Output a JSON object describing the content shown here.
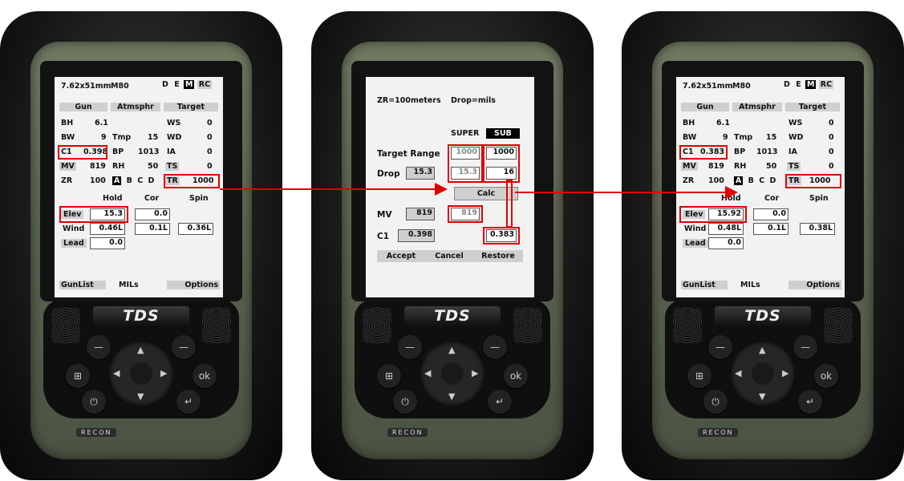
{
  "colors": {
    "highlight": "#e00000",
    "device_green": "#5b6450",
    "screen_bg": "#f2f2f2"
  },
  "main_screen_left": {
    "caliber": "7.62x51mm",
    "load": "M80",
    "modes": [
      "D",
      "E",
      "M",
      "RC"
    ],
    "gun_header": "Gun",
    "atm_header": "Atmsphr",
    "target_header": "Target",
    "bh_label": "BH",
    "bh_value": "6.1",
    "bw_label": "BW",
    "bw_value": "9",
    "c1_label": "C1",
    "c1_value": "0.398",
    "mv_label": "MV",
    "mv_value": "819",
    "zr_label": "ZR",
    "zr_value": "100",
    "tmp_label": "Tmp",
    "tmp_value": "15",
    "bp_label": "BP",
    "bp_value": "1013",
    "rh_label": "RH",
    "rh_value": "50",
    "set_labels": [
      "A",
      "B",
      "C",
      "D"
    ],
    "ws_label": "WS",
    "ws_value": "0",
    "wd_label": "WD",
    "wd_value": "0",
    "ia_label": "IA",
    "ia_value": "0",
    "ts_label": "TS",
    "ts_value": "0",
    "tr_label": "TR",
    "tr_value": "1000",
    "hold_header": "Hold",
    "cor_header": "Cor",
    "spin_header": "Spin",
    "elev_label": "Elev",
    "elev_value": "15.3",
    "elev_cor": "0.0",
    "wind_label": "Wind",
    "wind_value": "0.46L",
    "wind_cor": "0.1L",
    "wind_spin": "0.36L",
    "lead_label": "Lead",
    "lead_value": "0.0",
    "gunlist": "GunList",
    "units": "MILs",
    "options": "Options"
  },
  "calc_screen": {
    "zr_text": "ZR=100meters",
    "drop_text": "Drop=mils",
    "super_label": "SUPER",
    "sub_label": "SUB",
    "target_range_label": "Target Range",
    "range_old": "1000",
    "range_new": "1000",
    "drop_label": "Drop",
    "drop_value": "15.3",
    "drop_old": "15.3",
    "drop_new": "16",
    "calc_button": "Calc",
    "mv_label": "MV",
    "mv_value": "819",
    "mv_old": "819",
    "c1_label": "C1",
    "c1_value": "0.398",
    "c1_new": "0.383",
    "accept": "Accept",
    "cancel": "Cancel",
    "restore": "Restore"
  },
  "main_screen_right": {
    "caliber": "7.62x51mm",
    "load": "M80",
    "modes": [
      "D",
      "E",
      "M",
      "RC"
    ],
    "gun_header": "Gun",
    "atm_header": "Atmsphr",
    "target_header": "Target",
    "bh_label": "BH",
    "bh_value": "6.1",
    "bw_label": "BW",
    "bw_value": "9",
    "c1_label": "C1",
    "c1_value": "0.383",
    "mv_label": "MV",
    "mv_value": "819",
    "zr_label": "ZR",
    "zr_value": "100",
    "tmp_label": "Tmp",
    "tmp_value": "15",
    "bp_label": "BP",
    "bp_value": "1013",
    "rh_label": "RH",
    "rh_value": "50",
    "set_labels": [
      "A",
      "B",
      "C",
      "D"
    ],
    "ws_label": "WS",
    "ws_value": "0",
    "wd_label": "WD",
    "wd_value": "0",
    "ia_label": "IA",
    "ia_value": "0",
    "ts_label": "TS",
    "ts_value": "0",
    "tr_label": "TR",
    "tr_value": "1000",
    "hold_header": "Hold",
    "cor_header": "Cor",
    "spin_header": "Spin",
    "elev_label": "Elev",
    "elev_value": "15.92",
    "elev_cor": "0.0",
    "wind_label": "Wind",
    "wind_value": "0.48L",
    "wind_cor": "0.1L",
    "wind_spin": "0.38L",
    "lead_label": "Lead",
    "lead_value": "0.0",
    "gunlist": "GunList",
    "units": "MILs",
    "options": "Options"
  },
  "device": {
    "brand": "TDS",
    "model": "RECON",
    "ok_label": "ok",
    "windows_icon": "windows-icon",
    "power_icon": "power-icon",
    "enter_icon": "enter-icon"
  }
}
